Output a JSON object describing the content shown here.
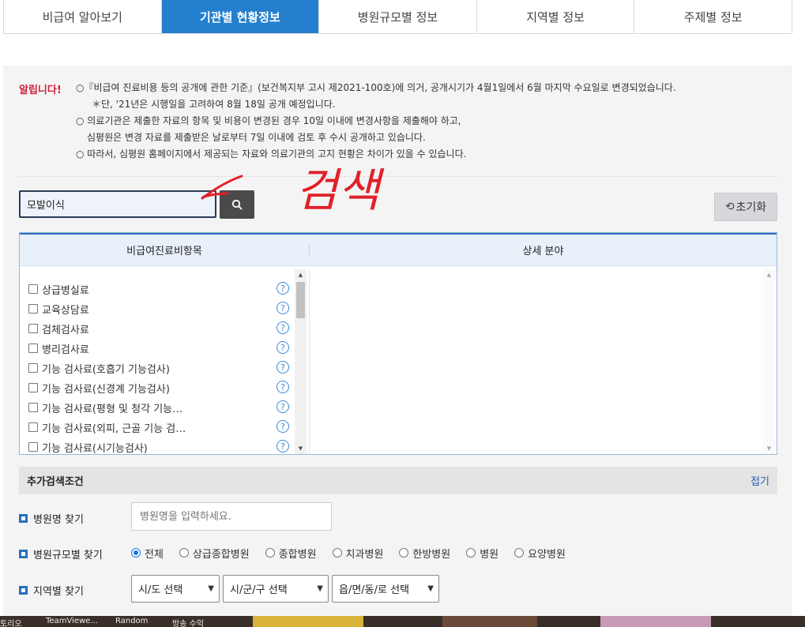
{
  "tabs": [
    {
      "label": "비급여 알아보기",
      "active": false
    },
    {
      "label": "기관별 현황정보",
      "active": true
    },
    {
      "label": "병원규모별 정보",
      "active": false
    },
    {
      "label": "지역별 정보",
      "active": false
    },
    {
      "label": "주제별 정보",
      "active": false
    }
  ],
  "notice": {
    "label": "알립니다!",
    "lines": [
      "○『비급여 진료비용 등의 공개에 관한 기준』(보건복지부 고시 제2021-100호)에 의거, 공개시기가 4월1일에서 6월 마지막 수요일로 변경되었습니다.",
      "＊단, '21년은 시행일을 고려하여 8월 18일 공개 예정입니다.",
      "○ 의료기관은 제출한 자료의 항목 및 비용이 변경된 경우 10일 이내에 변경사항을 제출해야 하고,",
      "심평원은 변경 자료를 제출받은 날로부터 7일 이내에 검토 후 수시 공개하고 있습니다.",
      "○ 따라서, 심평원 홈페이지에서 제공되는 자료와 의료기관의 고지 현황은 차이가 있을 수 있습니다."
    ]
  },
  "search": {
    "value": "모발이식"
  },
  "reset_label": "초기화",
  "annotation_text": "검색",
  "table": {
    "col1": "비급여진료비항목",
    "col2": "상세 분야",
    "items": [
      "상급병실료",
      "교육상담료",
      "검체검사료",
      "병리검사료",
      "기능 검사료(호흡기 기능검사)",
      "기능 검사료(신경계 기능검사)",
      "기능 검사료(평형 및 청각 기능…",
      "기능 검사료(외피, 근골 기능 검…",
      "기능 검사료(시기능검사)"
    ],
    "help_glyph": "?"
  },
  "advanced": {
    "title": "추가검색조건",
    "toggle": "접기",
    "hospital_name_label": "병원명 찾기",
    "hospital_name_placeholder": "병원명을 입력하세요.",
    "size_label": "병원규모별 찾기",
    "size_options": [
      "전체",
      "상급종합병원",
      "종합병원",
      "치과병원",
      "한방병원",
      "병원",
      "요양병원"
    ],
    "size_selected": 0,
    "region_label": "지역별 찾기",
    "region_selects": [
      "시/도 선택",
      "시/군/구 선택",
      "읍/면/동/로 선택"
    ]
  },
  "taskbar": [
    "토리오",
    "TeamViewe...",
    "Random",
    "방송 수익"
  ],
  "colors": {
    "accent": "#2480cf",
    "notice_red": "#d0203a",
    "annotation_red": "#e0202a"
  }
}
